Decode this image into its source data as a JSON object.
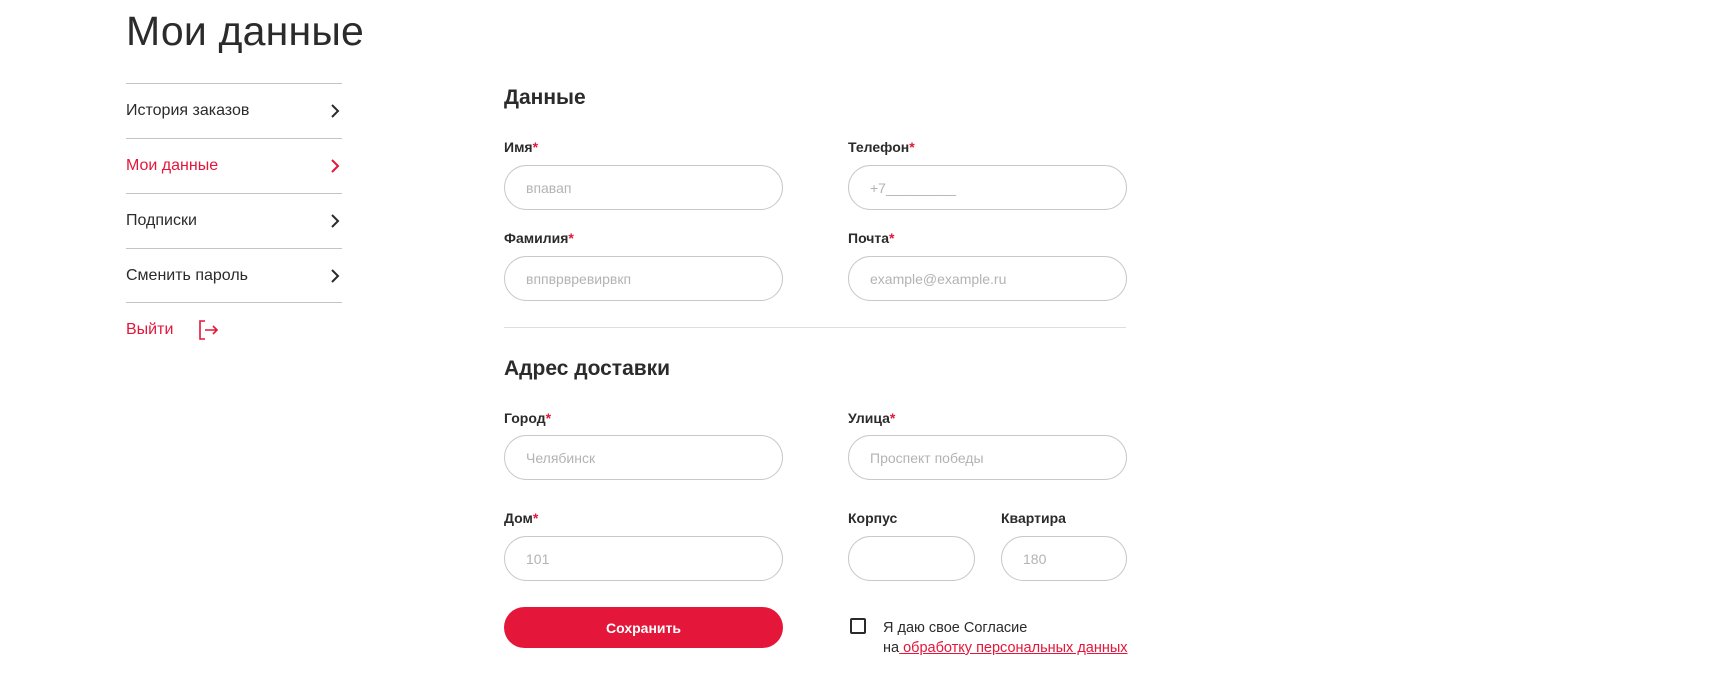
{
  "page": {
    "title": "Мои данные"
  },
  "sidebar": {
    "items": [
      {
        "label": "История заказов",
        "active": false
      },
      {
        "label": "Мои данные",
        "active": true
      },
      {
        "label": "Подписки",
        "active": false
      },
      {
        "label": "Сменить пароль",
        "active": false
      }
    ],
    "logout_label": "Выйти"
  },
  "personal": {
    "title": "Данные",
    "name": {
      "label": "Имя",
      "placeholder": "впавап"
    },
    "phone": {
      "label": "Телефон",
      "placeholder": "+7_________"
    },
    "surname": {
      "label": "Фамилия",
      "placeholder": "вппврвревирвкп"
    },
    "email": {
      "label": "Почта",
      "placeholder": "example@example.ru"
    }
  },
  "address": {
    "title": "Адрес доставки",
    "city": {
      "label": "Город",
      "placeholder": "Челябинск"
    },
    "street": {
      "label": "Улица",
      "placeholder": "Проспект победы"
    },
    "house": {
      "label": "Дом",
      "placeholder": "101"
    },
    "building": {
      "label": "Корпус",
      "placeholder": ""
    },
    "apartment": {
      "label": "Квартира",
      "placeholder": "180"
    }
  },
  "required_mark": "*",
  "actions": {
    "save_label": "Сохранить"
  },
  "consent": {
    "line1": "Я даю свое Согласие",
    "prefix": "на",
    "link": " обработку персональных данных"
  },
  "colors": {
    "accent": "#e4163a",
    "text": "#2b2b2b",
    "border": "#c8c8c8"
  }
}
